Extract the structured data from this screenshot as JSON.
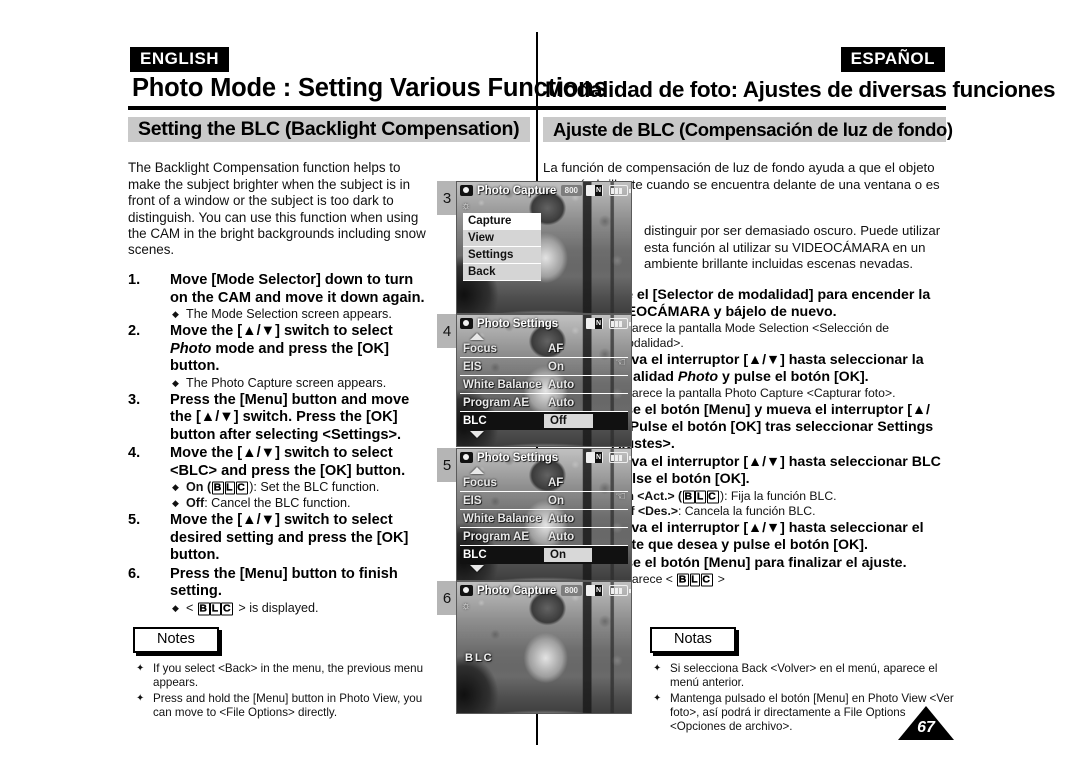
{
  "header": {
    "lang_en": "ENGLISH",
    "lang_es": "ESPAÑOL",
    "title_en": "Photo Mode : Setting Various Functions",
    "title_es": "Modalidad de foto: Ajustes de diversas funciones"
  },
  "section": {
    "title_en": "Setting the BLC (Backlight Compensation)",
    "title_es": "Ajuste de BLC (Compensación de luz de fondo)"
  },
  "english": {
    "intro": "The Backlight Compensation function helps to make the subject brighter when the subject is in front of a window or the subject is too dark to distinguish. You can use this function when using the CAM in the bright backgrounds including snow scenes.",
    "steps": [
      {
        "num": "1.",
        "text": "Move [Mode Selector] down to turn on the CAM and move it down again.",
        "bullets": [
          "The Mode Selection screen appears."
        ]
      },
      {
        "num": "2.",
        "text_before": "Move the [▲/▼] switch to select ",
        "italic": "Photo",
        "text_after": " mode and press the [OK] button.",
        "bullets": [
          "The Photo Capture screen appears."
        ]
      },
      {
        "num": "3.",
        "text": "Press the [Menu] button and move the [▲/▼] switch. Press the [OK] button after selecting <Settings>.",
        "bullets": []
      },
      {
        "num": "4.",
        "text": "Move the [▲/▼] switch to select <BLC> and press the [OK] button.",
        "bullets": []
      },
      {
        "num": "5.",
        "text": "Move the [▲/▼] switch to select desired setting and press the [OK] button.",
        "bullets": []
      },
      {
        "num": "6.",
        "text": "Press the [Menu] button to finish setting.",
        "bullets": []
      }
    ],
    "bullet_on_prefix": "On (",
    "bullet_on_suffix": "): Set the BLC function.",
    "bullet_off_label": "Off",
    "bullet_off_text": ": Cancel the BLC function.",
    "bullet_displayed_prefix": "<",
    "bullet_displayed_suffix": "> is displayed.",
    "notes_label": "Notes",
    "notes": [
      "If you select <Back> in the menu, the previous menu appears.",
      "Press and hold the [Menu] button in Photo View, you can move to <File Options> directly."
    ]
  },
  "spanish": {
    "intro_part1": "La función de compensación de luz de fondo ayuda a que el objeto sea más brillante cuando se encuentra delante de una ventana o es muy difícil de",
    "intro_part2": "distinguir por ser demasiado oscuro. Puede utilizar esta función al utilizar su VIDEOCÁMARA en un ambiente brillante incluidas escenas nevadas.",
    "steps": [
      {
        "num": "1.",
        "text": "Baje el [Selector de modalidad] para encender la VIDEOCÁMARA y bájelo de nuevo.",
        "bullets": [
          "Aparece la pantalla Mode Selection <Selección de modalidad>."
        ]
      },
      {
        "num": "2.",
        "text_before": "Mueva el interruptor [▲/▼] hasta seleccionar la modalidad ",
        "italic": "Photo",
        "text_after": " y pulse el botón [OK].",
        "bullets": [
          "Aparece la pantalla Photo Capture <Capturar foto>."
        ]
      },
      {
        "num": "3.",
        "text": "Pulse el botón [Menu] y mueva el interruptor [▲/▼]. Pulse el botón [OK] tras seleccionar Settings <Ajustes>.",
        "bullets": []
      },
      {
        "num": "4.",
        "text": "Mueva el interruptor [▲/▼] hasta seleccionar BLC y pulse el botón [OK].",
        "bullets": []
      },
      {
        "num": "5.",
        "text": "Mueva el interruptor [▲/▼] hasta seleccionar el ajuste que desea y pulse el botón [OK].",
        "bullets": []
      },
      {
        "num": "6.",
        "text": "Pulse el botón [Menu] para finalizar el ajuste.",
        "bullets": []
      }
    ],
    "bullet_on_prefix": "On <Act.> (",
    "bullet_on_suffix": "): Fija la función BLC.",
    "bullet_off_label": "Off <Des.>",
    "bullet_off_text": ": Cancela la función BLC.",
    "bullet_displayed_prefix": "Aparece <",
    "bullet_displayed_suffix": ">",
    "notes_label": "Notas",
    "notes": [
      "Si selecciona Back <Volver> en el menú, aparece el menú anterior.",
      "Mantenga pulsado el botón [Menu] en Photo View <Ver foto>, así podrá ir directamente a File Options <Opciones de archivo>."
    ]
  },
  "blc_glyph": {
    "b": "B",
    "l": "L",
    "c": "C"
  },
  "screens": [
    {
      "step_num": "3",
      "type": "menu-popup",
      "osd_title": "Photo Capture",
      "resolution": "800",
      "menu_items": [
        {
          "label": "Capture",
          "selected": true
        },
        {
          "label": "View",
          "selected": false
        },
        {
          "label": "Settings",
          "selected": false
        },
        {
          "label": "Back",
          "selected": false
        }
      ]
    },
    {
      "step_num": "4",
      "type": "settings",
      "osd_title": "Photo Settings",
      "rows": [
        {
          "label": "Focus",
          "value": "AF",
          "highlight": false
        },
        {
          "label": "EIS",
          "value": "On",
          "highlight": false
        },
        {
          "label": "White Balance",
          "value": "Auto",
          "highlight": false
        },
        {
          "label": "Program AE",
          "value": "Auto",
          "highlight": false
        },
        {
          "label": "BLC",
          "value": "Off",
          "highlight": true
        }
      ]
    },
    {
      "step_num": "5",
      "type": "settings",
      "osd_title": "Photo Settings",
      "rows": [
        {
          "label": "Focus",
          "value": "AF",
          "highlight": false
        },
        {
          "label": "EIS",
          "value": "On",
          "highlight": false
        },
        {
          "label": "White Balance",
          "value": "Auto",
          "highlight": false
        },
        {
          "label": "Program AE",
          "value": "Auto",
          "highlight": false
        },
        {
          "label": "BLC",
          "value": "On",
          "highlight": true
        }
      ]
    },
    {
      "step_num": "6",
      "type": "preview",
      "osd_title": "Photo Capture",
      "resolution": "800",
      "osd_blc": "BLC"
    }
  ],
  "page_number": "67"
}
